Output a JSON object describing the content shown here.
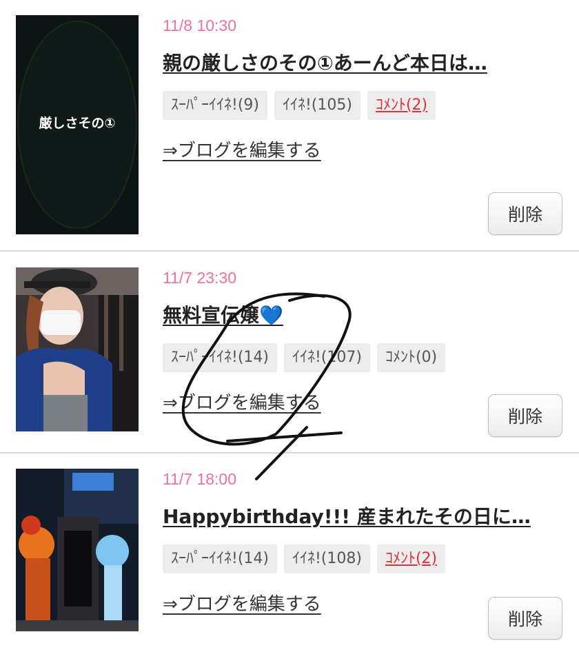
{
  "entries": [
    {
      "date": "11/8 10:30",
      "title": "親の厳しさのその①あーんど本日は…",
      "title_emoji": "",
      "thumb_caption": "厳しさその①",
      "super_like": "ｽｰﾊﾟｰｲｲﾈ!(9)",
      "like": "ｲｲﾈ!(105)",
      "comment": "ｺﾒﾝﾄ(2)",
      "edit_link": "⇒ブログを編集する",
      "delete_label": "削除"
    },
    {
      "date": "11/7 23:30",
      "title": "無料宣伝嬢",
      "title_emoji": "💙",
      "thumb_caption": "",
      "super_like": "ｽｰﾊﾟｰｲｲﾈ!(14)",
      "like": "ｲｲﾈ!(107)",
      "comment": "ｺﾒﾝﾄ(0)",
      "edit_link": "⇒ブログを編集する",
      "delete_label": "削除"
    },
    {
      "date": "11/7 18:00",
      "title": "Happybirthday!!! 産まれたその日に…",
      "title_emoji": "",
      "thumb_caption": "",
      "super_like": "ｽｰﾊﾟｰｲｲﾈ!(14)",
      "like": "ｲｲﾈ!(108)",
      "comment": "ｺﾒﾝﾄ(2)",
      "edit_link": "⇒ブログを編集する",
      "delete_label": "削除"
    }
  ],
  "colors": {
    "date": "#ef6fa1",
    "comment_active": "#e0303c",
    "tag_bg": "#ececec",
    "annotation": "#111111"
  }
}
